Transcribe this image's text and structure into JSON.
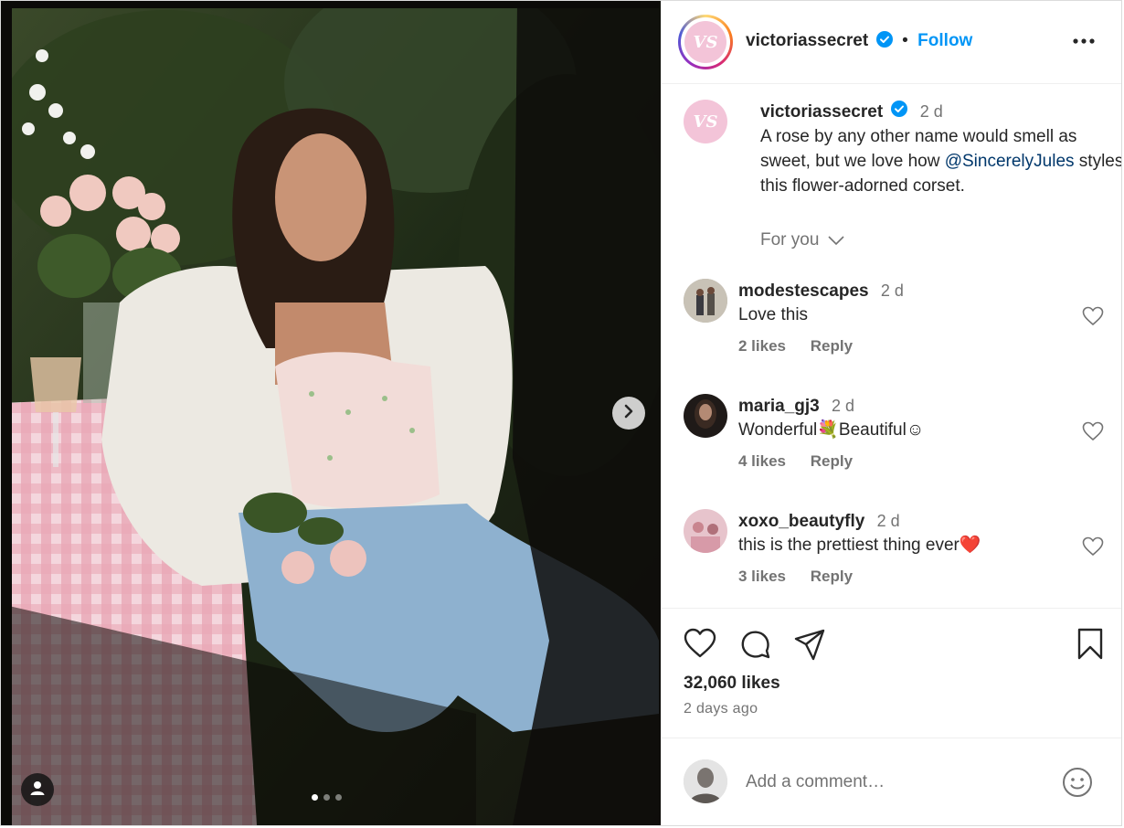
{
  "post": {
    "author": "victoriassecret",
    "logo_text": "VS",
    "follow_label": "Follow",
    "more_icon": "more-horizontal-icon",
    "caption_author": "victoriassecret",
    "caption_time": "2 d",
    "caption_pre": "A rose by any other name would smell as sweet, but we love how ",
    "caption_mention": "@SincerelyJules",
    "caption_post": " styles this flower-adorned corset.",
    "for_you_label": "For you",
    "carousel": {
      "current": 1,
      "total": 3
    }
  },
  "comments": [
    {
      "user": "modestescapes",
      "time": "2 d",
      "text": "Love this",
      "likes": "2 likes",
      "reply": "Reply"
    },
    {
      "user": "maria_gj3",
      "time": "2 d",
      "text": "Wonderful💐Beautiful☺",
      "likes": "4 likes",
      "reply": "Reply"
    },
    {
      "user": "xoxo_beautyfly",
      "time": "2 d",
      "text": "this is the prettiest thing ever❤️",
      "likes": "3 likes",
      "reply": "Reply"
    }
  ],
  "stats": {
    "likes": "32,060 likes",
    "posted": "2 days ago"
  },
  "add_comment": {
    "placeholder": "Add a comment…"
  },
  "colors": {
    "accent": "#0095f6",
    "verified": "#0095f6",
    "mention": "#00376b",
    "logo_pink": "#f3c4d8"
  }
}
